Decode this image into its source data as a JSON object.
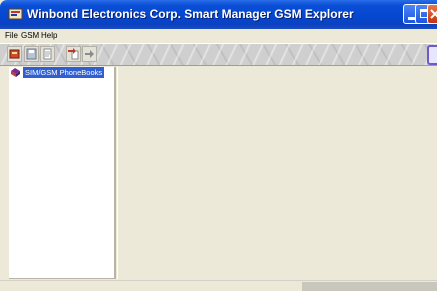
{
  "window": {
    "title": "Winbond Electronics Corp. Smart Manager GSM Explorer",
    "accent": "#0a4fd6"
  },
  "menu": {
    "items": [
      "File",
      "GSM",
      "Help"
    ]
  },
  "toolbar": {
    "buttons": [
      "connect-icon",
      "save-icon",
      "document-icon",
      "export-icon",
      "forward-icon"
    ]
  },
  "tree": {
    "items": [
      {
        "label": "SIM/GSM PhoneBooks",
        "selected": true,
        "icon": "phonebook-icon"
      }
    ]
  },
  "selection_color": "#2f5fd1"
}
